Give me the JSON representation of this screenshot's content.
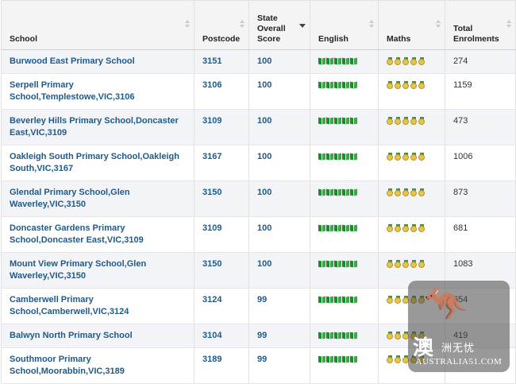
{
  "columns": [
    {
      "key": "school",
      "label": "School",
      "sortable": true,
      "active": false
    },
    {
      "key": "postcode",
      "label": "Postcode",
      "sortable": true,
      "active": false
    },
    {
      "key": "score",
      "label": "State Overall Score",
      "sortable": true,
      "active": true
    },
    {
      "key": "english",
      "label": "English",
      "sortable": true,
      "active": false
    },
    {
      "key": "maths",
      "label": "Maths",
      "sortable": true,
      "active": false
    },
    {
      "key": "enrolments",
      "label": "Total Enrolments",
      "sortable": true,
      "active": false
    }
  ],
  "rows": [
    {
      "school": "Burwood East Primary School",
      "postcode": "3151",
      "score": "100",
      "english": 5,
      "maths": 5,
      "enrolments": "274"
    },
    {
      "school": "Serpell Primary School,Templestowe,VIC,3106",
      "postcode": "3106",
      "score": "100",
      "english": 5,
      "maths": 5,
      "enrolments": "1159"
    },
    {
      "school": "Beverley Hills Primary School,Doncaster East,VIC,3109",
      "postcode": "3109",
      "score": "100",
      "english": 5,
      "maths": 5,
      "enrolments": "473"
    },
    {
      "school": "Oakleigh South Primary School,Oakleigh South,VIC,3167",
      "postcode": "3167",
      "score": "100",
      "english": 5,
      "maths": 5,
      "enrolments": "1006"
    },
    {
      "school": "Glendal Primary School,Glen Waverley,VIC,3150",
      "postcode": "3150",
      "score": "100",
      "english": 5,
      "maths": 5,
      "enrolments": "873"
    },
    {
      "school": "Doncaster Gardens Primary School,Doncaster East,VIC,3109",
      "postcode": "3109",
      "score": "100",
      "english": 5,
      "maths": 5,
      "enrolments": "681"
    },
    {
      "school": "Mount View Primary School,Glen Waverley,VIC,3150",
      "postcode": "3150",
      "score": "100",
      "english": 5,
      "maths": 5,
      "enrolments": "1083"
    },
    {
      "school": "Camberwell Primary School,Camberwell,VIC,3124",
      "postcode": "3124",
      "score": "99",
      "english": 5,
      "maths": 5,
      "enrolments": "654"
    },
    {
      "school": "Balwyn North Primary School",
      "postcode": "3104",
      "score": "99",
      "english": 5,
      "maths": 5,
      "enrolments": "419"
    },
    {
      "school": "Southmoor Primary School,Moorabbin,VIC,3189",
      "postcode": "3189",
      "score": "99",
      "english": 5,
      "maths": 5,
      "enrolments": "-"
    }
  ],
  "icons": {
    "english": "book-icon",
    "maths": "medal-icon"
  },
  "colors": {
    "link": "#1f5a8c",
    "header_bg": "#f4f4f4",
    "alt_row_bg": "#f3f4f7"
  },
  "watermark": {
    "big": "澳",
    "small": "洲无忧",
    "en": "AUSTRALIA51.COM"
  }
}
